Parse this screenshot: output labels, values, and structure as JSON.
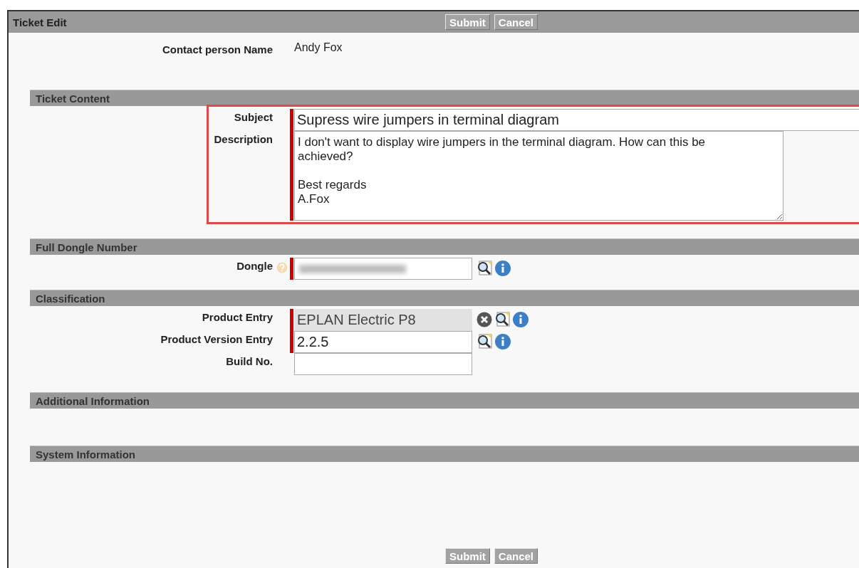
{
  "window": {
    "title": "Ticket Edit"
  },
  "top_buttons": [
    "Submit",
    "Cancel"
  ],
  "contact": {
    "label": "Contact person Name",
    "value": "Andy Fox"
  },
  "sections": [
    {
      "title": "Ticket Content",
      "highlighted": true,
      "fields": [
        {
          "label": "Subject",
          "kind": "text",
          "required": true,
          "value": "Supress wire jumpers in terminal diagram"
        },
        {
          "label": "Description",
          "kind": "textarea",
          "required": true,
          "value": "I don't want to display wire jumpers in the terminal diagram. How can this be achieved?\n\nBest regards\nA.Fox"
        }
      ]
    },
    {
      "title": "Full Dongle Number",
      "fields": [
        {
          "label": "Dongle",
          "kind": "text",
          "required": true,
          "help": true,
          "redacted": true,
          "icons": [
            {
              "kind": "lookup"
            },
            {
              "kind": "info"
            }
          ]
        }
      ]
    },
    {
      "title": "Classification",
      "fields": [
        {
          "label": "Product Entry",
          "kind": "text",
          "required": true,
          "disabled": true,
          "value": "EPLAN Electric P8",
          "icons": [
            {
              "kind": "clear"
            },
            {
              "kind": "lookup"
            },
            {
              "kind": "info"
            }
          ]
        },
        {
          "label": "Product Version Entry",
          "kind": "text",
          "required": true,
          "disabled": false,
          "value": "2.2.5",
          "icons": [
            {
              "kind": "lookup"
            },
            {
              "kind": "info"
            }
          ]
        },
        {
          "label": "Build No.",
          "kind": "text",
          "required": false,
          "disabled": false
        }
      ]
    },
    {
      "title": "Additional Information"
    },
    {
      "title": "System Information"
    }
  ],
  "bottom_buttons": [
    "Submit",
    "Cancel"
  ]
}
